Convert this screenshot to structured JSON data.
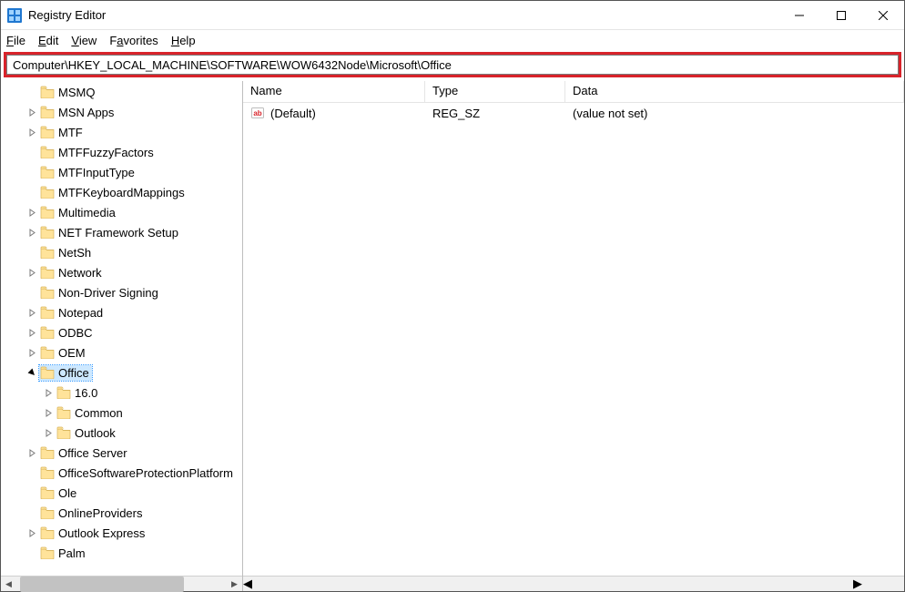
{
  "window": {
    "title": "Registry Editor"
  },
  "menu": {
    "file": "File",
    "edit": "Edit",
    "view": "View",
    "favorites": "Favorites",
    "help": "Help"
  },
  "address": {
    "value": "Computer\\HKEY_LOCAL_MACHINE\\SOFTWARE\\WOW6432Node\\Microsoft\\Office"
  },
  "tree": {
    "items": [
      {
        "label": "MSMQ",
        "indent": 1,
        "expand": "none"
      },
      {
        "label": "MSN Apps",
        "indent": 1,
        "expand": "closed"
      },
      {
        "label": "MTF",
        "indent": 1,
        "expand": "closed"
      },
      {
        "label": "MTFFuzzyFactors",
        "indent": 1,
        "expand": "none"
      },
      {
        "label": "MTFInputType",
        "indent": 1,
        "expand": "none"
      },
      {
        "label": "MTFKeyboardMappings",
        "indent": 1,
        "expand": "none"
      },
      {
        "label": "Multimedia",
        "indent": 1,
        "expand": "closed"
      },
      {
        "label": "NET Framework Setup",
        "indent": 1,
        "expand": "closed"
      },
      {
        "label": "NetSh",
        "indent": 1,
        "expand": "none"
      },
      {
        "label": "Network",
        "indent": 1,
        "expand": "closed"
      },
      {
        "label": "Non-Driver Signing",
        "indent": 1,
        "expand": "none"
      },
      {
        "label": "Notepad",
        "indent": 1,
        "expand": "closed"
      },
      {
        "label": "ODBC",
        "indent": 1,
        "expand": "closed"
      },
      {
        "label": "OEM",
        "indent": 1,
        "expand": "closed"
      },
      {
        "label": "Office",
        "indent": 1,
        "expand": "open",
        "selected": true
      },
      {
        "label": "16.0",
        "indent": 2,
        "expand": "closed"
      },
      {
        "label": "Common",
        "indent": 2,
        "expand": "closed"
      },
      {
        "label": "Outlook",
        "indent": 2,
        "expand": "closed"
      },
      {
        "label": "Office Server",
        "indent": 1,
        "expand": "closed"
      },
      {
        "label": "OfficeSoftwareProtectionPlatform",
        "indent": 1,
        "expand": "none"
      },
      {
        "label": "Ole",
        "indent": 1,
        "expand": "none"
      },
      {
        "label": "OnlineProviders",
        "indent": 1,
        "expand": "none"
      },
      {
        "label": "Outlook Express",
        "indent": 1,
        "expand": "closed"
      },
      {
        "label": "Palm",
        "indent": 1,
        "expand": "none"
      }
    ]
  },
  "list": {
    "columns": {
      "name": "Name",
      "type": "Type",
      "data": "Data"
    },
    "rows": [
      {
        "name": "(Default)",
        "type": "REG_SZ",
        "data": "(value not set)"
      }
    ]
  }
}
